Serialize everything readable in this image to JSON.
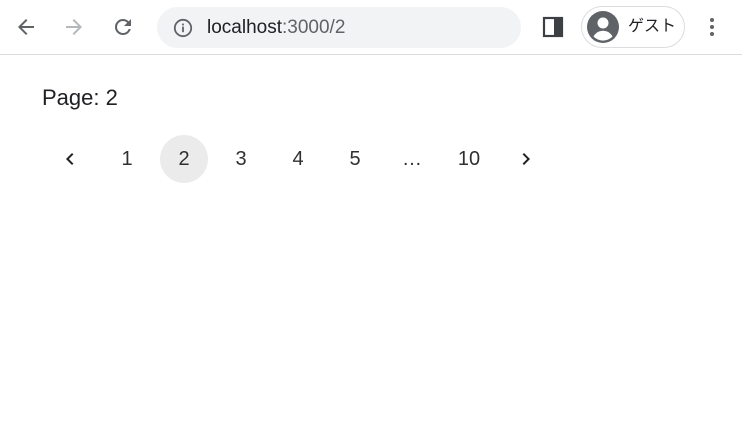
{
  "browser": {
    "url_host": "localhost",
    "url_path": ":3000/2",
    "profile_label": "ゲスト"
  },
  "page": {
    "label_prefix": "Page: ",
    "current_page": "2"
  },
  "pagination": {
    "items": [
      {
        "type": "prev",
        "icon": "chevron-left-icon"
      },
      {
        "type": "page",
        "label": "1"
      },
      {
        "type": "page",
        "label": "2",
        "selected": true
      },
      {
        "type": "page",
        "label": "3"
      },
      {
        "type": "page",
        "label": "4"
      },
      {
        "type": "page",
        "label": "5"
      },
      {
        "type": "ellipsis",
        "label": "…"
      },
      {
        "type": "page",
        "label": "10"
      },
      {
        "type": "next",
        "icon": "chevron-right-icon"
      }
    ]
  },
  "colors": {
    "selected_page_bg": "#ebebeb",
    "toolbar_icon": "#5f6368",
    "omnibox_bg": "#f1f3f4"
  }
}
